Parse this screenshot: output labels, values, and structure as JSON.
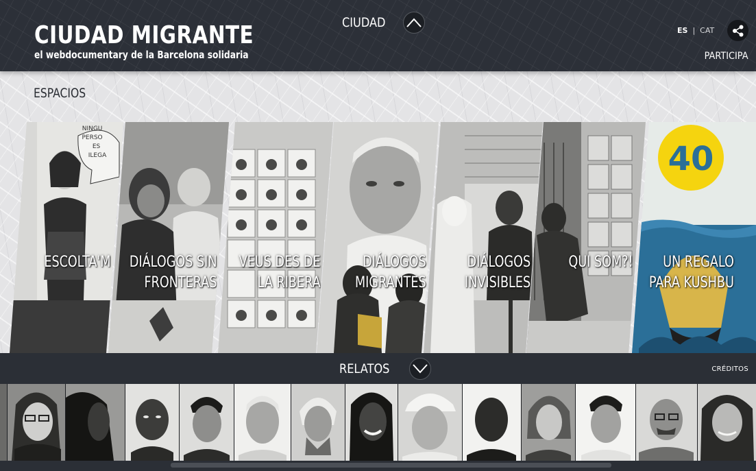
{
  "header": {
    "logo_title": "CIUDAD MIGRANTE",
    "logo_subtitle": "el webdocumentary de la Barcelona solidaria",
    "section_label": "CIUDAD",
    "lang_es": "ES",
    "lang_separator": "|",
    "lang_cat": "CAT",
    "share_icon": "share-icon",
    "participa": "PARTICIPA"
  },
  "espacios": {
    "heading": "ESPACIOS",
    "panels": [
      {
        "id": "escolta",
        "line1": "ESCOLTA'M",
        "line2": "",
        "bubble": [
          "NINGU",
          "PERSO",
          "ES",
          "ILEGA"
        ]
      },
      {
        "id": "dialogos-sin-fronteras",
        "line1": "DIÁLOGOS SIN",
        "line2": "FRONTERAS"
      },
      {
        "id": "veus-des-de-la-ribera",
        "line1": "VEUS DES DE",
        "line2": "LA RIBERA"
      },
      {
        "id": "dialogos-migrantes",
        "line1": "DIÁLOGOS",
        "line2": "MIGRANTES"
      },
      {
        "id": "dialogos-invisibles",
        "line1": "DIÁLOGOS",
        "line2": "INVISIBLES"
      },
      {
        "id": "qui-som",
        "line1": "QUI SOM?!",
        "line2": ""
      },
      {
        "id": "un-regalo-para-kushbu",
        "line1": "UN REGALO",
        "line2": "PARA KUSHBU",
        "badge": "40"
      }
    ]
  },
  "relatos": {
    "label": "RELATOS",
    "creditos": "CRÉDITOS"
  },
  "colors": {
    "header_bg": "#2c3038",
    "bar_bg": "#2b2f36",
    "page_bg": "#e4e4e6",
    "kushbu_yellow": "#f5d40f",
    "kushbu_blue": "#2b6f98"
  }
}
